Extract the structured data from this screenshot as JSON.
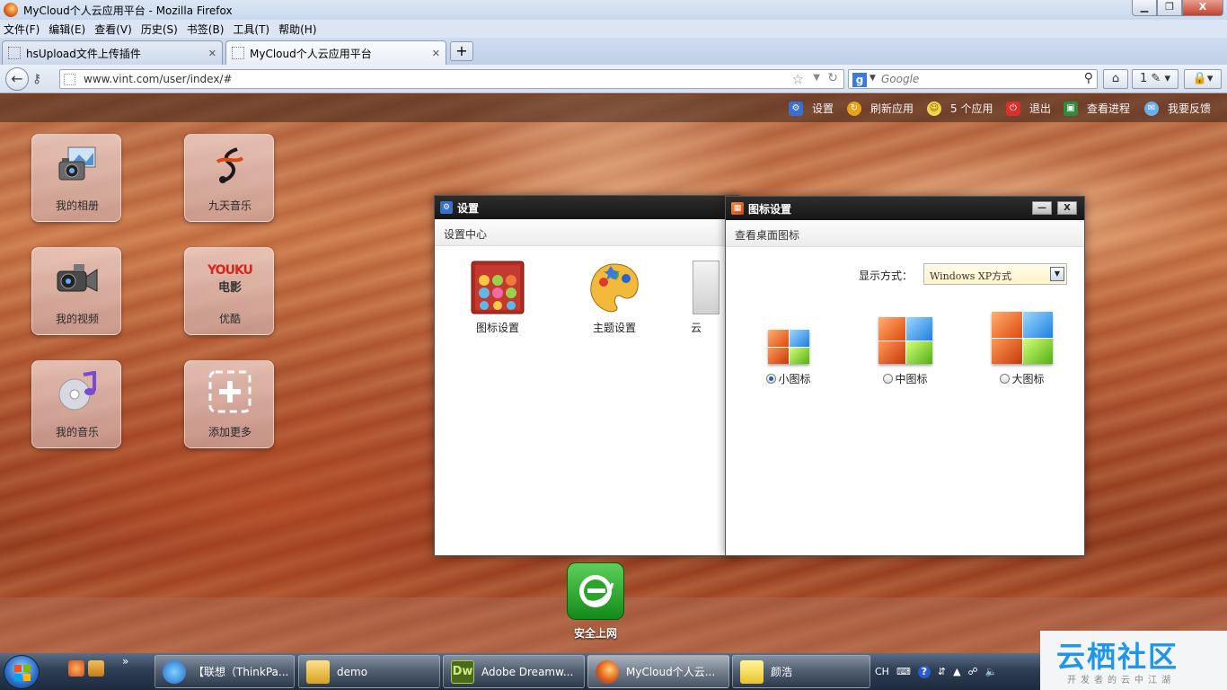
{
  "browser": {
    "window_title": "MyCloud个人云应用平台 - Mozilla Firefox",
    "menu": [
      "文件(F)",
      "编辑(E)",
      "查看(V)",
      "历史(S)",
      "书签(B)",
      "工具(T)",
      "帮助(H)"
    ],
    "tabs": [
      {
        "label": "hsUpload文件上传插件"
      },
      {
        "label": "MyCloud个人云应用平台"
      }
    ],
    "new_tab": "+",
    "url": "www.vint.com/user/index/#",
    "search_placeholder": "Google",
    "window_buttons": {
      "close": "X"
    }
  },
  "topbar": {
    "items": [
      {
        "label": "设置",
        "icon": "gear-icon"
      },
      {
        "label": "刷新应用",
        "icon": "refresh-icon"
      },
      {
        "label": "5 个应用",
        "icon": "apps-icon"
      },
      {
        "label": "退出",
        "icon": "power-icon"
      },
      {
        "label": "查看进程",
        "icon": "monitor-icon"
      },
      {
        "label": "我要反馈",
        "icon": "feedback-icon"
      }
    ]
  },
  "desktop_icons": [
    {
      "label": "我的相册",
      "icon": "camera-icon"
    },
    {
      "label": "九天音乐",
      "icon": "music-note-icon"
    },
    {
      "label": "我的视频",
      "icon": "video-camera-icon"
    },
    {
      "label": "优酷",
      "icon": "youku-logo",
      "logo_top": "YOUKU",
      "logo_bottom": "电影"
    },
    {
      "label": "我的音乐",
      "icon": "music-disc-icon"
    },
    {
      "label": "添加更多",
      "icon": "add-icon"
    }
  ],
  "settings_window": {
    "title": "设置",
    "subtitle": "设置中心",
    "items": [
      {
        "label": "图标设置",
        "icon": "icon-settings-icon"
      },
      {
        "label": "主题设置",
        "icon": "palette-icon"
      },
      {
        "label": "云",
        "icon": "cloud-settings-icon"
      }
    ]
  },
  "icon_settings_window": {
    "title": "图标设置",
    "subtitle": "查看桌面图标",
    "min_label": "—",
    "close_label": "X",
    "display_mode_label": "显示方式：",
    "display_mode_value": "Windows XP方式",
    "sizes": [
      {
        "label": "小图标",
        "selected": true
      },
      {
        "label": "中图标",
        "selected": false
      },
      {
        "label": "大图标",
        "selected": false
      }
    ]
  },
  "dock": {
    "app_label": "安全上网",
    "app_icon": "ie-browser-icon"
  },
  "taskbar": {
    "buttons": [
      {
        "label": "【联想（ThinkPa...",
        "icon": "ie-icon"
      },
      {
        "label": "demo",
        "icon": "folder-icon"
      },
      {
        "label": "Adobe Dreamw...",
        "icon": "dreamweaver-icon",
        "badge": "Dw"
      },
      {
        "label": "MyCloud个人云...",
        "icon": "firefox-icon"
      },
      {
        "label": "颜浩",
        "icon": "note-icon"
      }
    ],
    "tray_lang": "CH",
    "quicklaunch_more": "»"
  },
  "watermark": {
    "main": "云栖社区",
    "sub": "开发者的云中江湖"
  },
  "colors": {
    "accent": "#1f97e6",
    "window_header": "#1e1e1e",
    "dock_green": "#2aa52a"
  }
}
